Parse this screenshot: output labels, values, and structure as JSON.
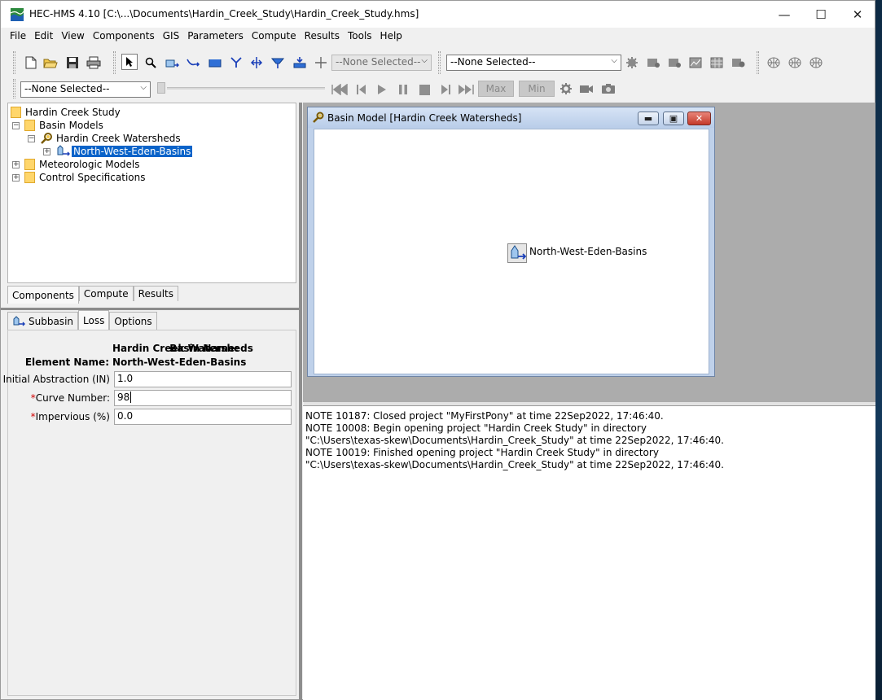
{
  "window": {
    "title": "HEC-HMS 4.10 [C:\\...\\Documents\\Hardin_Creek_Study\\Hardin_Creek_Study.hms]",
    "minimize_glyph": "—",
    "maximize_glyph": "☐",
    "close_glyph": "✕"
  },
  "menu": [
    "File",
    "Edit",
    "View",
    "Components",
    "GIS",
    "Parameters",
    "Compute",
    "Results",
    "Tools",
    "Help"
  ],
  "toolbar": {
    "element_selector": "--None Selected--",
    "run_selector": "--None Selected--",
    "time_selector": "--None Selected--",
    "max_label": "Max",
    "min_label": "Min"
  },
  "tree": {
    "project": "Hardin Creek Study",
    "basin_models": "Basin Models",
    "basin_model": "Hardin Creek Watersheds",
    "element": "North-West-Eden-Basins",
    "met_models": "Meteorologic Models",
    "control_specs": "Control Specifications"
  },
  "explorer_tabs": [
    "Components",
    "Compute",
    "Results"
  ],
  "editor_tabs": [
    "Subbasin",
    "Loss",
    "Options"
  ],
  "editor": {
    "basin_label": "Basin Name:",
    "basin_value": "Hardin Creek Watersheds",
    "element_label": "Element Name:",
    "element_value": "North-West-Eden-Basins",
    "initial_abstraction_label": "Initial Abstraction (IN)",
    "initial_abstraction_value": "1.0",
    "curve_number_label": "Curve Number:",
    "curve_number_value": "98",
    "impervious_label": "Impervious (%)",
    "impervious_value": "0.0"
  },
  "basin_window": {
    "title": "Basin Model [Hardin Creek Watersheds]",
    "node_label": "North-West-Eden-Basins"
  },
  "log": [
    "NOTE 10187:  Closed project \"MyFirstPony\" at time 22Sep2022, 17:46:40.",
    "NOTE 10008:  Begin opening project \"Hardin Creek Study\" in directory",
    "\"C:\\Users\\texas-skew\\Documents\\Hardin_Creek_Study\" at time 22Sep2022, 17:46:40.",
    "NOTE 10019:  Finished opening project \"Hardin Creek Study\" in directory",
    "\"C:\\Users\\texas-skew\\Documents\\Hardin_Creek_Study\" at time 22Sep2022, 17:46:40."
  ]
}
